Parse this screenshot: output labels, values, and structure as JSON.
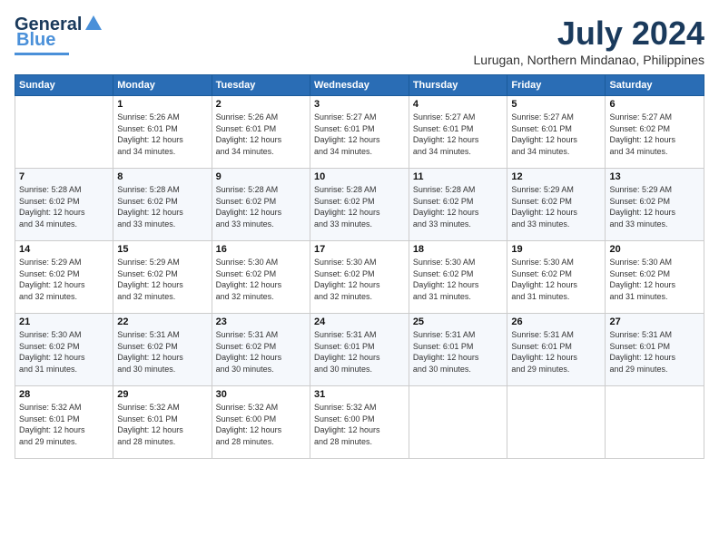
{
  "logo": {
    "text1": "General",
    "text2": "Blue"
  },
  "title": {
    "month_year": "July 2024",
    "location": "Lurugan, Northern Mindanao, Philippines"
  },
  "headers": [
    "Sunday",
    "Monday",
    "Tuesday",
    "Wednesday",
    "Thursday",
    "Friday",
    "Saturday"
  ],
  "weeks": [
    [
      {
        "day": "",
        "info": ""
      },
      {
        "day": "1",
        "info": "Sunrise: 5:26 AM\nSunset: 6:01 PM\nDaylight: 12 hours\nand 34 minutes."
      },
      {
        "day": "2",
        "info": "Sunrise: 5:26 AM\nSunset: 6:01 PM\nDaylight: 12 hours\nand 34 minutes."
      },
      {
        "day": "3",
        "info": "Sunrise: 5:27 AM\nSunset: 6:01 PM\nDaylight: 12 hours\nand 34 minutes."
      },
      {
        "day": "4",
        "info": "Sunrise: 5:27 AM\nSunset: 6:01 PM\nDaylight: 12 hours\nand 34 minutes."
      },
      {
        "day": "5",
        "info": "Sunrise: 5:27 AM\nSunset: 6:01 PM\nDaylight: 12 hours\nand 34 minutes."
      },
      {
        "day": "6",
        "info": "Sunrise: 5:27 AM\nSunset: 6:02 PM\nDaylight: 12 hours\nand 34 minutes."
      }
    ],
    [
      {
        "day": "7",
        "info": "Sunrise: 5:28 AM\nSunset: 6:02 PM\nDaylight: 12 hours\nand 34 minutes."
      },
      {
        "day": "8",
        "info": "Sunrise: 5:28 AM\nSunset: 6:02 PM\nDaylight: 12 hours\nand 33 minutes."
      },
      {
        "day": "9",
        "info": "Sunrise: 5:28 AM\nSunset: 6:02 PM\nDaylight: 12 hours\nand 33 minutes."
      },
      {
        "day": "10",
        "info": "Sunrise: 5:28 AM\nSunset: 6:02 PM\nDaylight: 12 hours\nand 33 minutes."
      },
      {
        "day": "11",
        "info": "Sunrise: 5:28 AM\nSunset: 6:02 PM\nDaylight: 12 hours\nand 33 minutes."
      },
      {
        "day": "12",
        "info": "Sunrise: 5:29 AM\nSunset: 6:02 PM\nDaylight: 12 hours\nand 33 minutes."
      },
      {
        "day": "13",
        "info": "Sunrise: 5:29 AM\nSunset: 6:02 PM\nDaylight: 12 hours\nand 33 minutes."
      }
    ],
    [
      {
        "day": "14",
        "info": "Sunrise: 5:29 AM\nSunset: 6:02 PM\nDaylight: 12 hours\nand 32 minutes."
      },
      {
        "day": "15",
        "info": "Sunrise: 5:29 AM\nSunset: 6:02 PM\nDaylight: 12 hours\nand 32 minutes."
      },
      {
        "day": "16",
        "info": "Sunrise: 5:30 AM\nSunset: 6:02 PM\nDaylight: 12 hours\nand 32 minutes."
      },
      {
        "day": "17",
        "info": "Sunrise: 5:30 AM\nSunset: 6:02 PM\nDaylight: 12 hours\nand 32 minutes."
      },
      {
        "day": "18",
        "info": "Sunrise: 5:30 AM\nSunset: 6:02 PM\nDaylight: 12 hours\nand 31 minutes."
      },
      {
        "day": "19",
        "info": "Sunrise: 5:30 AM\nSunset: 6:02 PM\nDaylight: 12 hours\nand 31 minutes."
      },
      {
        "day": "20",
        "info": "Sunrise: 5:30 AM\nSunset: 6:02 PM\nDaylight: 12 hours\nand 31 minutes."
      }
    ],
    [
      {
        "day": "21",
        "info": "Sunrise: 5:30 AM\nSunset: 6:02 PM\nDaylight: 12 hours\nand 31 minutes."
      },
      {
        "day": "22",
        "info": "Sunrise: 5:31 AM\nSunset: 6:02 PM\nDaylight: 12 hours\nand 30 minutes."
      },
      {
        "day": "23",
        "info": "Sunrise: 5:31 AM\nSunset: 6:02 PM\nDaylight: 12 hours\nand 30 minutes."
      },
      {
        "day": "24",
        "info": "Sunrise: 5:31 AM\nSunset: 6:01 PM\nDaylight: 12 hours\nand 30 minutes."
      },
      {
        "day": "25",
        "info": "Sunrise: 5:31 AM\nSunset: 6:01 PM\nDaylight: 12 hours\nand 30 minutes."
      },
      {
        "day": "26",
        "info": "Sunrise: 5:31 AM\nSunset: 6:01 PM\nDaylight: 12 hours\nand 29 minutes."
      },
      {
        "day": "27",
        "info": "Sunrise: 5:31 AM\nSunset: 6:01 PM\nDaylight: 12 hours\nand 29 minutes."
      }
    ],
    [
      {
        "day": "28",
        "info": "Sunrise: 5:32 AM\nSunset: 6:01 PM\nDaylight: 12 hours\nand 29 minutes."
      },
      {
        "day": "29",
        "info": "Sunrise: 5:32 AM\nSunset: 6:01 PM\nDaylight: 12 hours\nand 28 minutes."
      },
      {
        "day": "30",
        "info": "Sunrise: 5:32 AM\nSunset: 6:00 PM\nDaylight: 12 hours\nand 28 minutes."
      },
      {
        "day": "31",
        "info": "Sunrise: 5:32 AM\nSunset: 6:00 PM\nDaylight: 12 hours\nand 28 minutes."
      },
      {
        "day": "",
        "info": ""
      },
      {
        "day": "",
        "info": ""
      },
      {
        "day": "",
        "info": ""
      }
    ]
  ]
}
